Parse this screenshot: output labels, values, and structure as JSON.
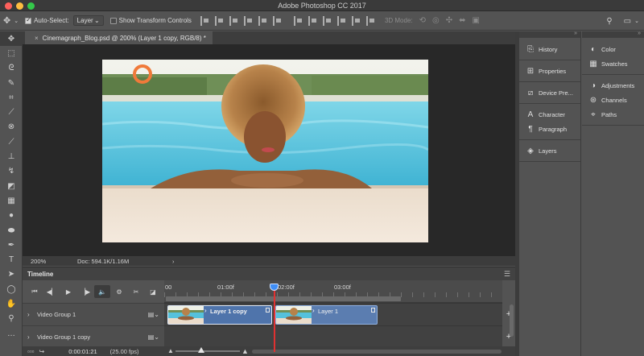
{
  "window": {
    "title": "Adobe Photoshop CC 2017"
  },
  "options_bar": {
    "auto_select_label": "Auto-Select:",
    "auto_select_checked": true,
    "auto_select_value": "Layer",
    "show_transform_label": "Show Transform Controls",
    "mode_3d_label": "3D Mode:"
  },
  "document": {
    "tab_title": "Cinemagraph_Blog.psd @ 200% (Layer 1 copy, RGB/8) *",
    "zoom": "200%",
    "doc_size": "Doc: 594.1K/1.16M"
  },
  "tools": [
    "move-tool",
    "marquee-tool",
    "lasso-tool",
    "quick-select-tool",
    "crop-tool",
    "eyedropper-tool",
    "healing-brush-tool",
    "brush-tool",
    "clone-stamp-tool",
    "history-brush-tool",
    "eraser-tool",
    "gradient-tool",
    "blur-tool",
    "dodge-tool",
    "pen-tool",
    "type-tool",
    "path-select-tool",
    "ellipse-tool",
    "hand-tool",
    "zoom-tool",
    "more-tools"
  ],
  "timeline": {
    "title": "Timeline",
    "ruler": [
      "00",
      "01:00f",
      "02:00f",
      "03:00f"
    ],
    "tracks": [
      {
        "name": "Video Group 1"
      },
      {
        "name": "Video Group 1 copy"
      }
    ],
    "clips": [
      {
        "label": "Layer 1 copy"
      },
      {
        "label": "Layer 1"
      }
    ],
    "current_time": "0:00:01:21",
    "fps": "(25.00 fps)"
  },
  "panels": {
    "column1": [
      "History",
      "Properties",
      "Device Pre...",
      "Character",
      "Paragraph",
      "Layers"
    ],
    "column2": [
      "Color",
      "Swatches",
      "Adjustments",
      "Channels",
      "Paths"
    ]
  }
}
